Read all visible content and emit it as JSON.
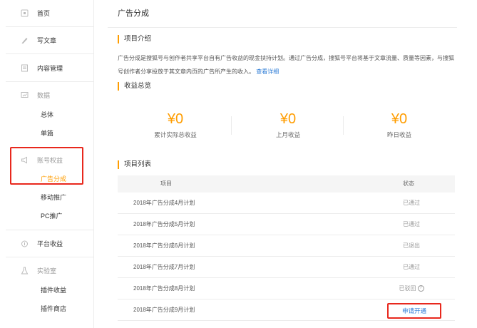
{
  "sidebar": {
    "items": [
      {
        "label": "首页",
        "icon": "home-icon"
      },
      {
        "label": "写文章",
        "icon": "pencil-icon"
      },
      {
        "label": "内容管理",
        "icon": "document-icon"
      },
      {
        "label": "数据",
        "icon": "chart-icon"
      },
      {
        "label": "账号权益",
        "icon": "megaphone-icon"
      },
      {
        "label": "平台收益",
        "icon": "money-bag-icon"
      },
      {
        "label": "实验室",
        "icon": "flask-icon"
      }
    ],
    "data_sub": [
      "总体",
      "单篇"
    ],
    "rights_sub": [
      "广告分成",
      "移动推广",
      "PC推广"
    ],
    "lab_sub": [
      "插件收益",
      "插件商店"
    ],
    "active_color": "#ff9d00"
  },
  "main": {
    "title": "广告分成",
    "intro_heading": "项目介绍",
    "intro_text": "广告分成是搜狐号与创作者共享平台自有广告收益的现金扶持计划。通过广告分成，搜狐号平台将基于文章流量、质量等因素，与搜狐号创作者分享投放于其文章内页的广告所产生的收入。",
    "intro_link": "查看详细",
    "summary_heading": "收益总览",
    "stats": [
      {
        "value": "¥0",
        "label": "累计实际总收益"
      },
      {
        "value": "¥0",
        "label": "上月收益"
      },
      {
        "value": "¥0",
        "label": "昨日收益"
      }
    ],
    "list_heading": "项目列表",
    "table": {
      "headers": [
        "项目",
        "状态"
      ],
      "rows": [
        {
          "name": "2018年广告分成4月计划",
          "status": "已通过"
        },
        {
          "name": "2018年广告分成5月计划",
          "status": "已通过"
        },
        {
          "name": "2018年广告分成6月计划",
          "status": "已退出"
        },
        {
          "name": "2018年广告分成7月计划",
          "status": "已通过"
        },
        {
          "name": "2018年广告分成8月计划",
          "status": "已驳回"
        },
        {
          "name": "2018年广告分成9月计划",
          "status": "申请开通"
        }
      ]
    }
  },
  "colors": {
    "accent": "#ff9d00",
    "link": "#2e7cd6",
    "highlight": "#e8281d"
  }
}
